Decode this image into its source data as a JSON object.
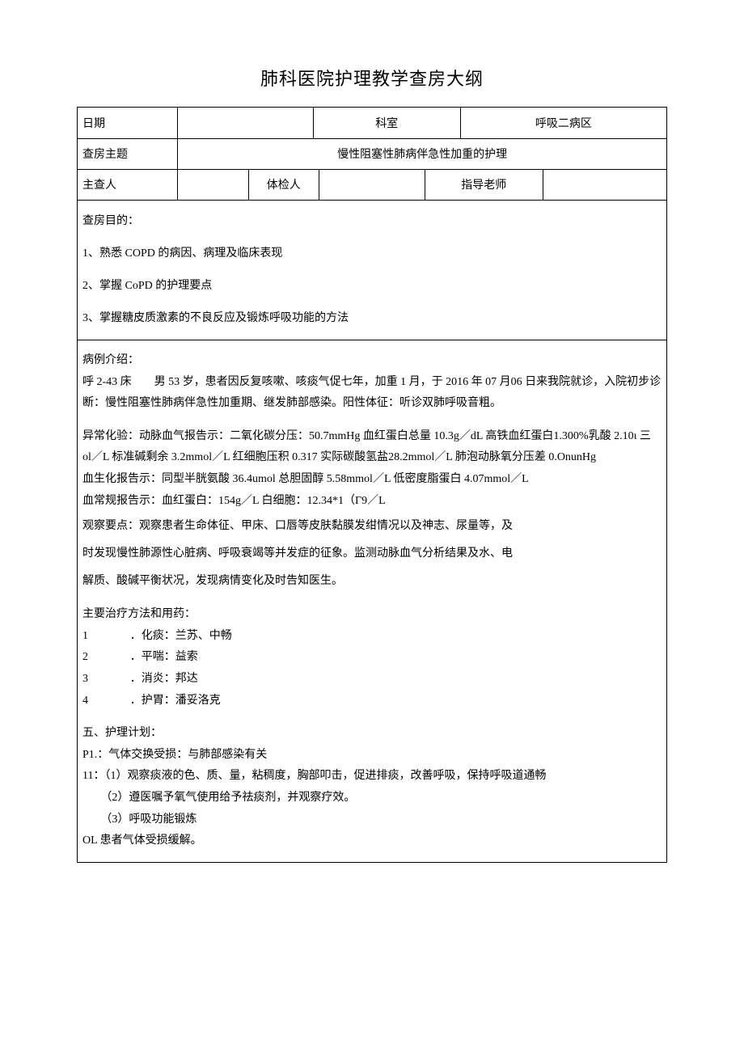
{
  "title": "肺科医院护理教学查房大纲",
  "header": {
    "row1": {
      "date_label": "日期",
      "date_value": "",
      "dept_label": "科室",
      "dept_value": "呼吸二病区"
    },
    "row2": {
      "topic_label": "查房主题",
      "topic_value": "慢性阻塞性肺病伴急性加重的护理"
    },
    "row3": {
      "host_label": "主查人",
      "host_value": "",
      "examiner_label": "体检人",
      "examiner_value": "",
      "supervisor_label": "指导老师",
      "supervisor_value": ""
    }
  },
  "objectives": {
    "heading": "查房目的：",
    "items": [
      "1、熟悉 COPD 的病因、病理及临床表现",
      "2、掌握 CoPD 的护理要点",
      "3、掌握糖皮质激素的不良反应及锻炼呼吸功能的方法"
    ]
  },
  "case": {
    "heading": "病例介绍：",
    "p1": "呼 2-43 床  男 53 岁，患者因反复咳嗽、咳痰气促七年，加重 1 月，于 2016 年 07 月06 日来我院就诊，入院初步诊断：慢性阻塞性肺病伴急性加重期、继发肺部感染。阳性体征：听诊双肺呼吸音粗。",
    "labs": {
      "l1": "异常化验：动脉血气报告示：二氧化碳分压：50.7mmHg 血红蛋白总量 10.3g／dL 高铁血红蛋白1.300%乳酸 2.10ι 三 ol／L 标准碱剩余 3.2mmol／L 红细胞压积 0.317 实际碳酸氢盐28.2mmol／L 肺泡动脉氧分压差 0.OnunHg",
      "l2": "血生化报告示：同型半胱氨酸 36.4umol 总胆固醇 5.58mmol／L 低密度脂蛋白 4.07mmol／L",
      "l3": "血常规报告示：血红蛋白：154g／L 白细胞：12.34*1（Γ9／L"
    },
    "observe": [
      "观察要点：观察患者生命体征、甲床、口唇等皮肤黏膜发绀情况以及神志、尿量等，及",
      "时发现慢性肺源性心脏病、呼吸衰竭等并发症的征象。监测动脉血气分析结果及水、电",
      "解质、酸碱平衡状况，发现病情变化及时告知医生。"
    ]
  },
  "treatment": {
    "heading": "主要治疗方法和用药：",
    "items": [
      {
        "num": "1",
        "text": "．化痰：兰苏、中畅"
      },
      {
        "num": "2",
        "text": "．平喘：益索"
      },
      {
        "num": "3",
        "text": "．消炎：邦达"
      },
      {
        "num": "4",
        "text": "．护胃：潘妥洛克"
      }
    ]
  },
  "plan": {
    "heading": "五、护理计划：",
    "lines": [
      "P1.：气体交换受损：与肺部感染有关",
      "11：（1）观察痰液的色、质、量，粘稠度，胸部叩击，促进排痰，改善呼吸，保持呼吸道通畅",
      "（2）遵医嘱予氧气使用给予祛痰剂，并观察疗效。",
      "（3）呼吸功能锻炼",
      "OL 患者气体受损缓解。"
    ]
  }
}
